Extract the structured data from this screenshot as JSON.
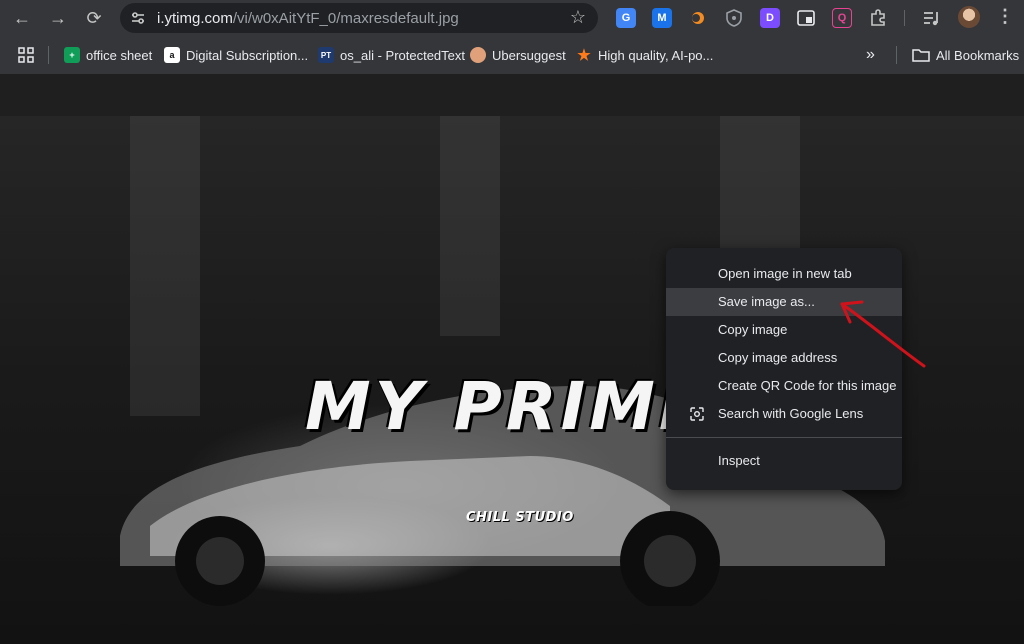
{
  "toolbar": {
    "back": "←",
    "forward": "→",
    "reload": "⟳",
    "url_host": "i.ytimg.com",
    "url_path": "/vi/w0xAitYtF_0/maxresdefault.jpg",
    "star": "☆",
    "extensions": [
      {
        "icon": "google-translate-icon",
        "glyph": "G",
        "color": "#4285f4"
      },
      {
        "icon": "m-extension-icon",
        "glyph": "M",
        "color": "#1a73e8"
      },
      {
        "icon": "drop-extension-icon",
        "glyph": "",
        "color": "#f28b22"
      },
      {
        "icon": "shield-extension-icon",
        "glyph": "",
        "color": "#9aa0a6"
      },
      {
        "icon": "d-extension-icon",
        "glyph": "D",
        "color": "#7c4dff"
      },
      {
        "icon": "window-extension-icon",
        "glyph": "",
        "color": "#e8eaed"
      },
      {
        "icon": "q-extension-icon",
        "glyph": "Q",
        "color": "#e84393"
      },
      {
        "icon": "puzzle-icon",
        "glyph": "",
        "color": "#c4c7c5"
      },
      {
        "icon": "media-control-icon",
        "glyph": "",
        "color": "#c4c7c5"
      }
    ],
    "kebab": "⋮"
  },
  "bookmarks": {
    "apps_icon": "apps-grid-icon",
    "items": [
      {
        "label": "office sheet",
        "icon": "sheets-icon",
        "color": "#0f9d58",
        "glyph": "+"
      },
      {
        "label": "Digital Subscription...",
        "icon": "amazon-icon",
        "color": "#ffffff",
        "glyph": "a"
      },
      {
        "label": "os_ali - ProtectedText",
        "icon": "pt-icon",
        "color": "#1e3a6e",
        "glyph": "PT"
      },
      {
        "label": "Ubersuggest",
        "icon": "ubersuggest-icon",
        "color": "#e0a07a",
        "glyph": ""
      },
      {
        "label": "High quality, AI-po...",
        "icon": "star-orange-icon",
        "color": "#ff7a1a",
        "glyph": "★"
      }
    ],
    "overflow": "»",
    "all_bookmarks": "All Bookmarks"
  },
  "image": {
    "title": "MY PRIME",
    "subtitle": "CHILL STUDIO"
  },
  "context_menu": {
    "items": [
      {
        "label": "Open image in new tab"
      },
      {
        "label": "Save image as..."
      },
      {
        "label": "Copy image"
      },
      {
        "label": "Copy image address"
      },
      {
        "label": "Create QR Code for this image"
      },
      {
        "label": "Search with Google Lens"
      }
    ],
    "inspect": "Inspect",
    "highlighted": "Save image as...",
    "annotation_color": "#d0121b"
  }
}
